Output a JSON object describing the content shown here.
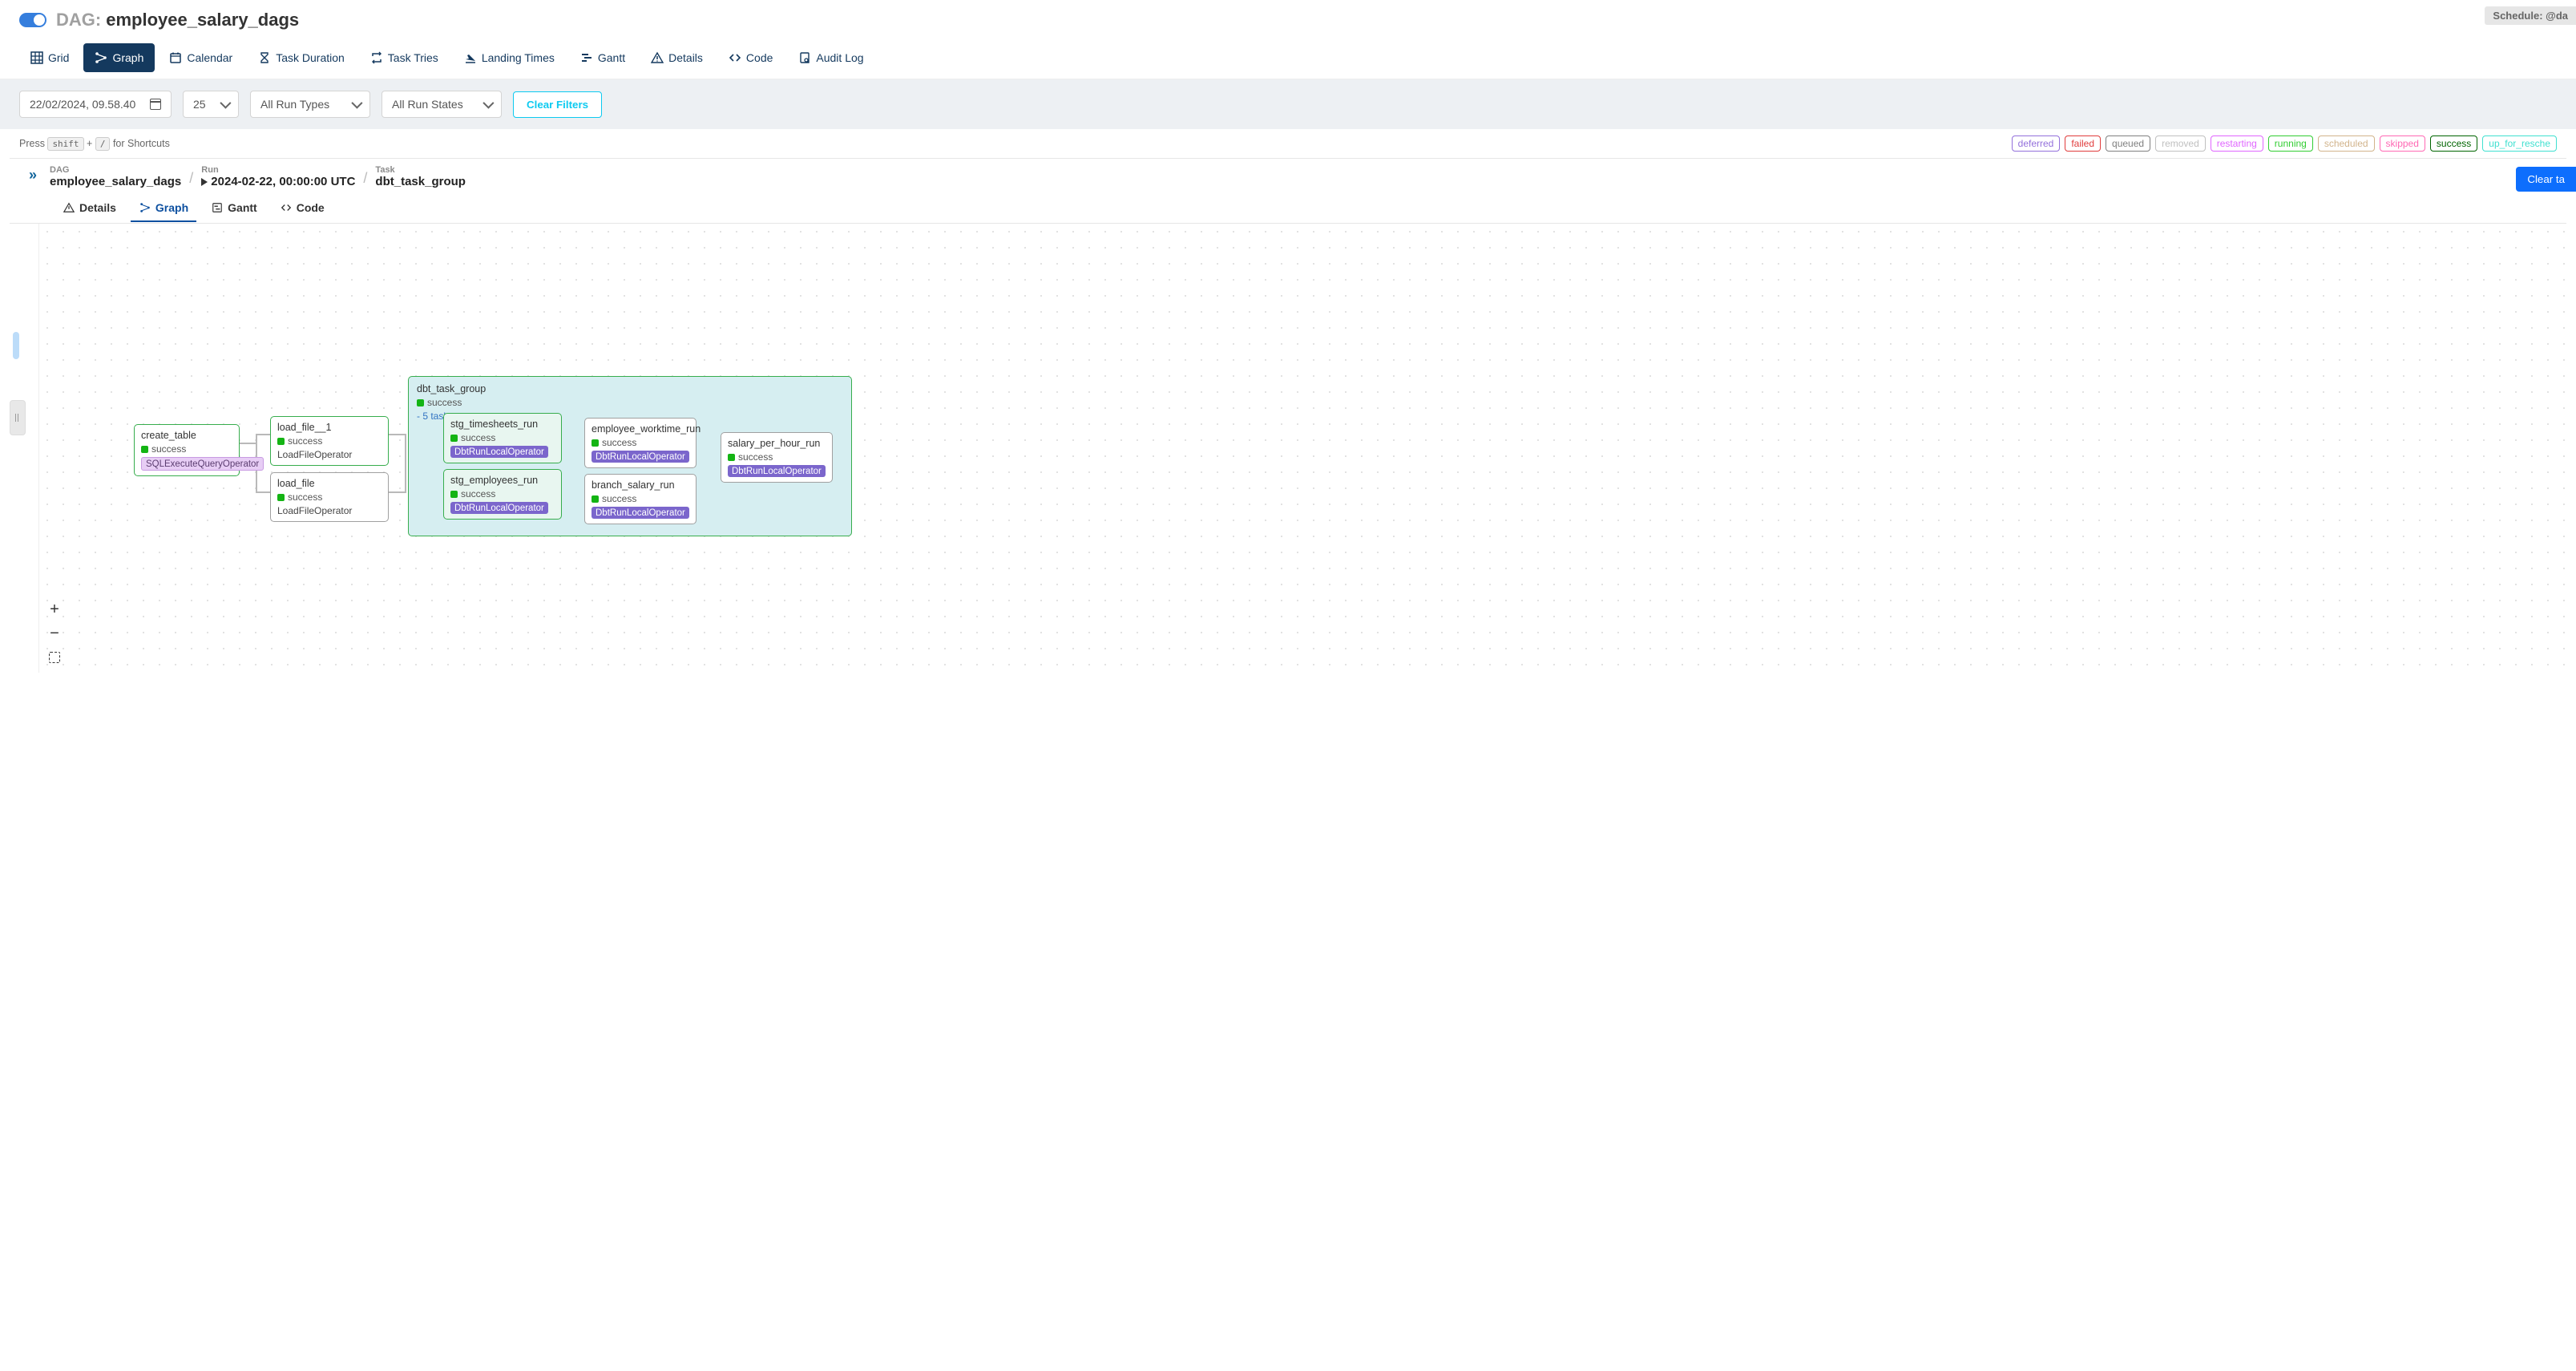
{
  "header": {
    "dag_prefix": "DAG:",
    "dag_name": "employee_salary_dags",
    "schedule_text": "Schedule: @da"
  },
  "main_tabs": [
    {
      "id": "grid",
      "label": "Grid"
    },
    {
      "id": "graph",
      "label": "Graph"
    },
    {
      "id": "calendar",
      "label": "Calendar"
    },
    {
      "id": "task-duration",
      "label": "Task Duration"
    },
    {
      "id": "task-tries",
      "label": "Task Tries"
    },
    {
      "id": "landing-times",
      "label": "Landing Times"
    },
    {
      "id": "gantt",
      "label": "Gantt"
    },
    {
      "id": "details",
      "label": "Details"
    },
    {
      "id": "code",
      "label": "Code"
    },
    {
      "id": "audit-log",
      "label": "Audit Log"
    }
  ],
  "active_main_tab": "graph",
  "filters": {
    "date": "22/02/2024, 09.58.40",
    "count": "25",
    "run_types": "All Run Types",
    "run_states": "All Run States",
    "clear_label": "Clear Filters"
  },
  "shortcuts": {
    "prefix": "Press",
    "key1": "shift",
    "plus": "+",
    "key2": "/",
    "suffix": "for Shortcuts"
  },
  "legend": [
    {
      "label": "deferred",
      "color": "#9370db"
    },
    {
      "label": "failed",
      "color": "#e03c3c"
    },
    {
      "label": "queued",
      "color": "#808080"
    },
    {
      "label": "removed",
      "color": "#c0c0c0"
    },
    {
      "label": "restarting",
      "color": "#e066ff"
    },
    {
      "label": "running",
      "color": "#32cd32"
    },
    {
      "label": "scheduled",
      "color": "#d2b48c"
    },
    {
      "label": "skipped",
      "color": "#ff69b4"
    },
    {
      "label": "success",
      "color": "#006400"
    },
    {
      "label": "up_for_resche",
      "color": "#40e0d0"
    }
  ],
  "breadcrumb": {
    "dag_label": "DAG",
    "dag_value": "employee_salary_dags",
    "run_label": "Run",
    "run_value": "2024-02-22, 00:00:00 UTC",
    "task_label": "Task",
    "task_value": "dbt_task_group",
    "clear_btn": "Clear ta"
  },
  "detail_tabs": [
    {
      "id": "details",
      "label": "Details"
    },
    {
      "id": "graph",
      "label": "Graph"
    },
    {
      "id": "gantt",
      "label": "Gantt"
    },
    {
      "id": "code",
      "label": "Code"
    }
  ],
  "active_detail_tab": "graph",
  "group": {
    "title": "dbt_task_group",
    "status": "success",
    "sub": "- 5 tasks"
  },
  "nodes": {
    "create_table": {
      "title": "create_table",
      "status": "success",
      "operator": "SQLExecuteQueryOperator"
    },
    "load_file_1": {
      "title": "load_file__1",
      "status": "success",
      "operator": "LoadFileOperator"
    },
    "load_file": {
      "title": "load_file",
      "status": "success",
      "operator": "LoadFileOperator"
    },
    "stg_timesheets": {
      "title": "stg_timesheets_run",
      "status": "success",
      "operator": "DbtRunLocalOperator"
    },
    "stg_employees": {
      "title": "stg_employees_run",
      "status": "success",
      "operator": "DbtRunLocalOperator"
    },
    "employee_worktime": {
      "title": "employee_worktime_run",
      "status": "success",
      "operator": "DbtRunLocalOperator"
    },
    "branch_salary": {
      "title": "branch_salary_run",
      "status": "success",
      "operator": "DbtRunLocalOperator"
    },
    "salary_per_hour": {
      "title": "salary_per_hour_run",
      "status": "success",
      "operator": "DbtRunLocalOperator"
    }
  }
}
